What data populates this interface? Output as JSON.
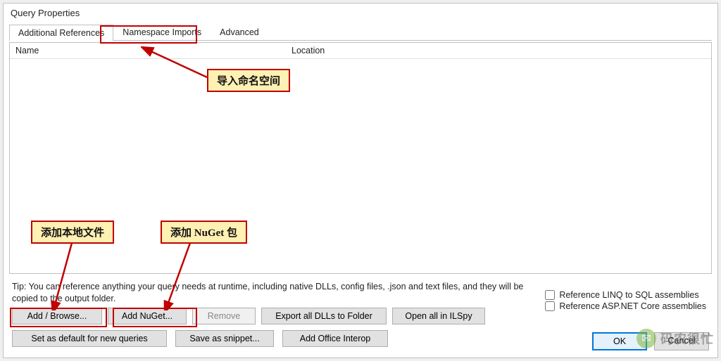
{
  "dialog": {
    "title": "Query Properties",
    "tabs": [
      {
        "label": "Additional References",
        "active": true
      },
      {
        "label": "Namespace Imports",
        "active": false
      },
      {
        "label": "Advanced",
        "active": false
      }
    ],
    "columns": {
      "name": "Name",
      "location": "Location"
    },
    "tip": "Tip: You can reference anything your query needs at runtime, including native DLLs, config files, .json and text files, and they will be copied to the output folder.",
    "buttons_row1": {
      "add_browse": "Add / Browse...",
      "add_nuget": "Add NuGet...",
      "remove": "Remove",
      "export_dlls": "Export all DLLs to Folder",
      "open_ilspy": "Open all in ILSpy"
    },
    "checks": {
      "linq_sql": "Reference LINQ to SQL assemblies",
      "aspnet": "Reference ASP.NET Core assemblies"
    },
    "buttons_row2": {
      "set_default": "Set as default for new queries",
      "save_snippet": "Save as snippet...",
      "office_interop": "Add Office Interop"
    },
    "ok": "OK",
    "cancel": "Cancel"
  },
  "annotations": {
    "namespace": "导入命名空间",
    "local_file": "添加本地文件",
    "nuget": "添加 NuGet 包"
  },
  "watermark": {
    "text": "码农很忙",
    "icon": "wechat-icon"
  }
}
